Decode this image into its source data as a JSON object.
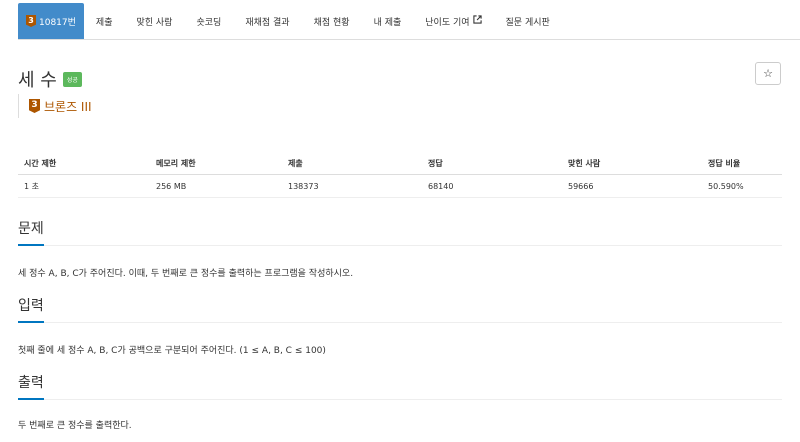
{
  "nav": {
    "problem_tab": {
      "tier_number": "3",
      "label": "10817번"
    },
    "items": [
      {
        "label": "제출"
      },
      {
        "label": "맞힌 사람"
      },
      {
        "label": "숏코딩"
      },
      {
        "label": "재채점 결과"
      },
      {
        "label": "채점 현황"
      },
      {
        "label": "내 제출"
      },
      {
        "label": "난이도 기여",
        "icon": "external-link-icon"
      },
      {
        "label": "질문 게시판"
      }
    ]
  },
  "problem": {
    "title": "세 수",
    "status_badge": "성공",
    "star_icon": "☆",
    "tier": {
      "number": "3",
      "label": "브론즈 III",
      "color": "#ad5600"
    }
  },
  "info_table": {
    "headers": [
      "시간 제한",
      "메모리 제한",
      "제출",
      "정답",
      "맞힌 사람",
      "정답 비율"
    ],
    "row": [
      "1 초",
      "256 MB",
      "138373",
      "68140",
      "59666",
      "50.590%"
    ]
  },
  "sections": {
    "description": {
      "title": "문제",
      "body": "세 정수 A, B, C가 주어진다. 이때, 두 번째로 큰 정수를 출력하는 프로그램을 작성하시오."
    },
    "input": {
      "title": "입력",
      "body": "첫째 줄에 세 정수 A, B, C가 공백으로 구분되어 주어진다. (1 ≤ A, B, C ≤ 100)"
    },
    "output": {
      "title": "출력",
      "body": "두 번째로 큰 정수를 출력한다."
    }
  },
  "colors": {
    "accent": "#428bca",
    "success": "#5cb85c",
    "bronze": "#ad5600",
    "section_underline": "#0076c0"
  }
}
